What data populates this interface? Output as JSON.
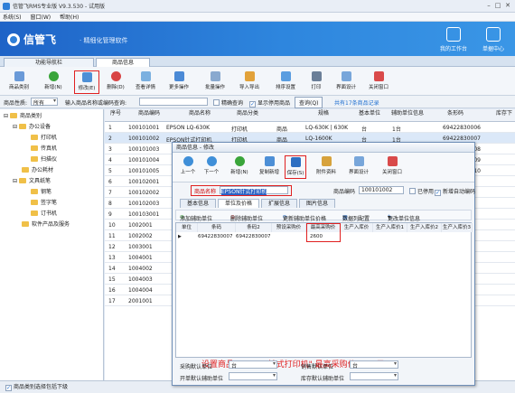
{
  "window": {
    "title": "信管飞RMS专业版 V9.3.530 - 试用版"
  },
  "menu": [
    "系统(S)",
    "窗口(W)",
    "帮助(H)"
  ],
  "banner": {
    "logo": "信管飞",
    "slogan": "· 精细化管理软件",
    "btn_workbench": "我的工作台",
    "btn_center": "单据中心"
  },
  "tabs": [
    "功能导航栏",
    "商品信息"
  ],
  "toolbar": [
    "商品类别",
    "新增(N)",
    "修改(E)",
    "删除(D)",
    "查看详情",
    "更多操作",
    "批量操作",
    "导入导出",
    "排序设置",
    "打印",
    "界面设计",
    "关闭窗口"
  ],
  "filter": {
    "label_prop": "商品性质:",
    "prop_value": "所有",
    "label_search": "输入商品名称或编码查询:",
    "precise": "精确查询",
    "show_disabled": "显示停用商品",
    "query": "查询(Q)",
    "summary": "共有17条商品记录"
  },
  "tree": {
    "root": "商品类别",
    "items": [
      "办公设备",
      "打印机",
      "传真机",
      "扫描仪",
      "办公耗材",
      "文具纸笔",
      "钢笔",
      "签字笔",
      "订书机",
      "软件产品及服务"
    ]
  },
  "grid": {
    "headers": [
      "序号",
      "商品编码",
      "商品名称",
      "商品分类",
      "规格",
      "基本单位",
      "辅助单位信息",
      "条形码",
      "库存下"
    ],
    "rows": [
      [
        "1",
        "100101001",
        "EPSON LQ-630K",
        "打印机",
        "商品",
        "LQ-630K | 630K",
        "台",
        "1台",
        "69422830006"
      ],
      [
        "2",
        "100101002",
        "EPSON针式打印机",
        "打印机",
        "商品",
        "LQ-1600K",
        "台",
        "1台",
        "69422830007"
      ],
      [
        "3",
        "100101003",
        "",
        "",
        "",
        "",
        "",
        "",
        "69422830008"
      ],
      [
        "4",
        "100101004",
        "",
        "",
        "",
        "",
        "",
        "",
        "69422830009"
      ],
      [
        "5",
        "100101005",
        "",
        "",
        "",
        "",
        "",
        "",
        "69422830010"
      ],
      [
        "6",
        "100102001",
        "",
        "",
        "",
        "",
        "",
        "",
        ""
      ],
      [
        "7",
        "100102002",
        "",
        "",
        "",
        "",
        "",
        "",
        ""
      ],
      [
        "8",
        "100102003",
        "",
        "",
        "",
        "",
        "",
        "",
        ""
      ],
      [
        "9",
        "100103001",
        "",
        "",
        "",
        "",
        "",
        "",
        ""
      ],
      [
        "10",
        "1002001",
        "",
        "",
        "",
        "",
        "",
        "",
        ""
      ],
      [
        "11",
        "1002002",
        "",
        "",
        "",
        "",
        "",
        "",
        ""
      ],
      [
        "12",
        "1003001",
        "",
        "",
        "",
        "",
        "",
        "",
        ""
      ],
      [
        "13",
        "1004001",
        "",
        "",
        "",
        "",
        "",
        "",
        ""
      ],
      [
        "14",
        "1004002",
        "",
        "",
        "",
        "",
        "",
        "",
        ""
      ],
      [
        "15",
        "1004003",
        "",
        "",
        "",
        "",
        "",
        "",
        ""
      ],
      [
        "16",
        "1004004",
        "",
        "",
        "",
        "",
        "",
        "",
        ""
      ],
      [
        "17",
        "2001001",
        "",
        "",
        "",
        "",
        "",
        "",
        ""
      ]
    ]
  },
  "status": {
    "include_sub": "商品类别选择包括下级"
  },
  "dialog": {
    "title": "商品信息 - 修改",
    "tools": [
      "上一个",
      "下一个",
      "新增(N)",
      "复制新增",
      "保存(S)",
      "附件资料",
      "界面设计",
      "关闭窗口"
    ],
    "name_label": "商品名称",
    "name_value": "EPSON针式打印机",
    "code_label": "商品编码",
    "code_value": "100101002",
    "disabled": "已停用",
    "auto_code": "新增自动编码",
    "tabs": [
      "基本信息",
      "单位及价格",
      "扩展信息",
      "图片信息"
    ],
    "sub_tools": [
      "添加辅助单位",
      "删除辅助单位",
      "更新辅助单位价格",
      "数据列配置",
      "更改单位信息"
    ],
    "inner_headers": [
      "单位",
      "条码",
      "条码2",
      "预设采购价",
      "最高采购价",
      "生产入库价",
      "生产入库价1",
      "生产入库价2",
      "生产入库价3"
    ],
    "inner_row": {
      "barcode": "69422830007",
      "barcode2": "69422830007",
      "max_purchase": "2600"
    },
    "note": "设置商品 \"EPSON针式打印机\" 最高采购价2600元",
    "f_purchase_unit": "采购默认单位",
    "f_sales_unit": "销售默认单位",
    "f_open_unit": "开单默认辅助单位",
    "f_stock_unit": "库存默认辅助单位",
    "v_purchase_unit": "台",
    "v_sales_unit": "台",
    "v_open_unit": "",
    "v_stock_unit": ""
  },
  "colors": {
    "accent": "#1f6fd0",
    "highlight": "#e02020",
    "banner": "#2679d4"
  }
}
